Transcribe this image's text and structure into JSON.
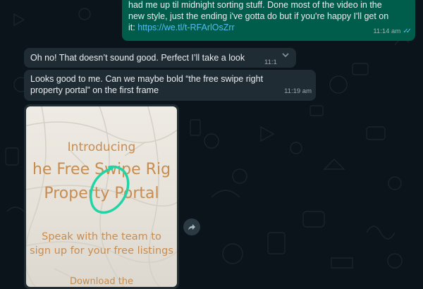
{
  "messages": [
    {
      "direction": "outgoing",
      "lines": [
        "had me up til midnight sorting stuff. Done most of the video in the",
        "new style, just the ending i've gotta do but if you're happy I'll get on",
        "it: "
      ],
      "link": "https://we.tl/t-RFArlOsZrr",
      "time": "11:14 am",
      "status": "read"
    },
    {
      "direction": "incoming",
      "text": "Oh no! That doesn’t sound good. Perfect I’ll take a look",
      "time": "11:1"
    },
    {
      "direction": "incoming",
      "line1": "Looks good to me. Can we maybe bold “the free swipe right",
      "line2": "property portal” on the first frame",
      "time": "11:19 am"
    }
  ],
  "media": {
    "line1": "Introducing",
    "line2": "he Free Swipe Rig",
    "line3": "Property Portal",
    "line4": "Speak with the team to",
    "line5": "sign up for your free listings",
    "line6": "Download the"
  },
  "colors": {
    "wallpaper": "#0b141a",
    "outgoing_bubble": "#005c4b",
    "incoming_bubble": "#202c33",
    "link": "#53bdeb",
    "poster_text": "#c88c4f",
    "annotation_circle": "#22d3a6"
  },
  "icons": {
    "read_receipt": "double-check-icon",
    "message_menu": "chevron-down-icon",
    "forward": "forward-icon"
  }
}
